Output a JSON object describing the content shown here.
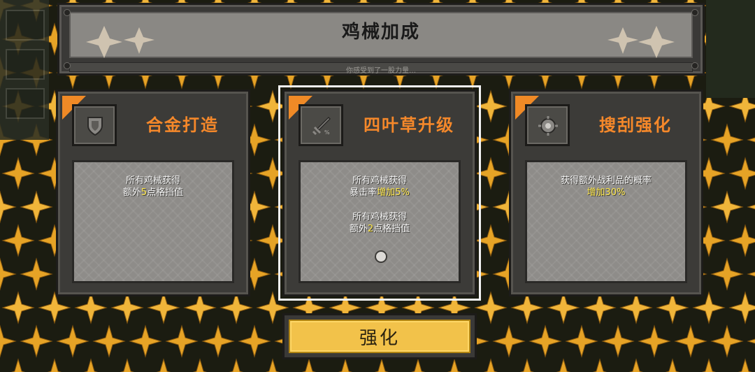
{
  "header": {
    "title": "鸡械加成",
    "subtitle": "你感受到了一股力量…"
  },
  "cards": [
    {
      "title": "合金打造",
      "icon": "shield-icon",
      "desc_lines": [
        {
          "pre": "所有鸡械获得",
          "hl": "",
          "post": ""
        },
        {
          "pre": "额外",
          "hl": "5",
          "post": "点格挡值"
        }
      ]
    },
    {
      "title": "四叶草升级",
      "icon": "sword-icon",
      "desc_lines": [
        {
          "pre": "所有鸡械获得",
          "hl": "",
          "post": ""
        },
        {
          "pre": "暴击率",
          "hl": "增加5%",
          "post": ""
        },
        {
          "pre": "所有鸡械获得",
          "hl": "",
          "post": ""
        },
        {
          "pre": "额外",
          "hl": "2",
          "post": "点格挡值"
        }
      ],
      "selected": true
    },
    {
      "title": "搜刮强化",
      "icon": "loot-icon",
      "desc_lines": [
        {
          "pre": "获得额外战利品的概率",
          "hl": "",
          "post": ""
        },
        {
          "pre": "",
          "hl": "增加30%",
          "post": ""
        }
      ]
    }
  ],
  "confirm_label": "强化",
  "colors": {
    "accent_orange": "#f5882a",
    "highlight_yellow": "#ffe84a",
    "button_gold": "#f2c24a"
  }
}
